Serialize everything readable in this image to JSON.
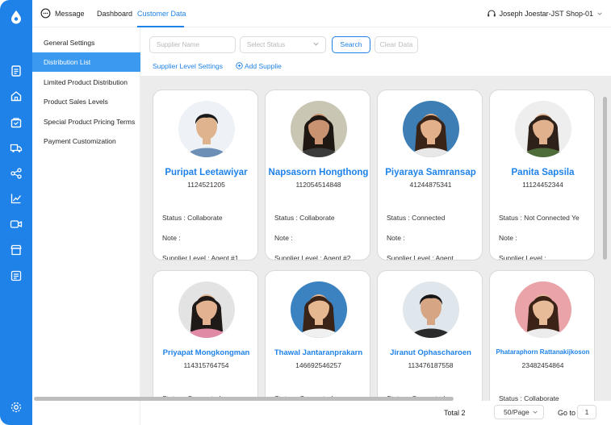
{
  "topbar": {
    "tabs": [
      {
        "label": "Message"
      },
      {
        "label": "Dashboard"
      },
      {
        "label": "Customer Data"
      }
    ],
    "user": "Joseph Joestar-JST Shop-01"
  },
  "menu": {
    "items": [
      {
        "label": "General Settings"
      },
      {
        "label": "Distribution List"
      },
      {
        "label": "Limited Product Distribution"
      },
      {
        "label": "Product Sales Levels"
      },
      {
        "label": "Special Product Pricing Terms"
      },
      {
        "label": "Payment Customization"
      }
    ],
    "active_index": 1
  },
  "filters": {
    "supplier_name_placeholder": "Supplier Name",
    "status_placeholder": "Select Status",
    "search_label": "Search",
    "clear_label": "Clear Data",
    "level_settings_link": "Supplier Level Settings",
    "add_supplier_link": "Add Supplie"
  },
  "labels": {
    "status": "Status : ",
    "note": "Note : ",
    "level": "Supplier Level : "
  },
  "suppliers": [
    {
      "name": "Puripat Leetawiyar",
      "id": "1124521205",
      "status": "Collaborate",
      "note": "",
      "level": "Agent #1",
      "avatar_bg": "#eef2f6",
      "skin": "#e0b38f",
      "hair": "#1a1a1a",
      "shirt": "#6d8fb5",
      "hair_style": "short"
    },
    {
      "name": "Napsasorn Hongthong",
      "id": "112054514848",
      "status": "Collaborate",
      "note": "",
      "level": "Agent #2",
      "avatar_bg": "#c9c6b4",
      "skin": "#c99371",
      "hair": "#1e1712",
      "shirt": "#3b3b3b",
      "hair_style": "long"
    },
    {
      "name": "Piyaraya Samransap",
      "id": "41244875341",
      "status": "Connected",
      "note": "",
      "level": "Agent",
      "avatar_bg": "#3d7fb5",
      "skin": "#e2b08a",
      "hair": "#3a2418",
      "shirt": "#e8e8e8",
      "hair_style": "long"
    },
    {
      "name": "Panita Sapsila",
      "id": "11124452344",
      "status": "Not Connected Ye",
      "note": "",
      "level": "",
      "avatar_bg": "#eeeeee",
      "skin": "#e1b08c",
      "hair": "#2e2119",
      "shirt": "#4e6b3a",
      "hair_style": "long"
    },
    {
      "name": "Priyapat Mongkongman",
      "id": "114315764754",
      "status": "Connected",
      "note": "",
      "level": "",
      "avatar_bg": "#e3e3e3",
      "skin": "#e3b391",
      "hair": "#1f1a17",
      "shirt": "#e08aa6",
      "hair_style": "long"
    },
    {
      "name": "Thawal Jantaranprakarn",
      "id": "146692546257",
      "status": "Connected",
      "note": "",
      "level": "",
      "avatar_bg": "#3b82c0",
      "skin": "#e6b892",
      "hair": "#3a2317",
      "shirt": "#f0f0f0",
      "hair_style": "long"
    },
    {
      "name": "Jiranut Ophascharoen",
      "id": "113476187558",
      "status": "Connected",
      "note": "",
      "level": "",
      "avatar_bg": "#dfe6ec",
      "skin": "#d6a583",
      "hair": "#161616",
      "shirt": "#2b2b2b",
      "hair_style": "short"
    },
    {
      "name": "Phataraphorn Rattanakijkoson",
      "id": "23482454864",
      "status": "Collaborate",
      "note": "",
      "level": "",
      "avatar_bg": "#e9a3a9",
      "skin": "#e8bb98",
      "hair": "#3b2417",
      "shirt": "#ececec",
      "hair_style": "long"
    }
  ],
  "pagination": {
    "total": "Total 2",
    "page_size": "50/Page",
    "goto_label": "Go to",
    "goto_value": "1"
  },
  "colors": {
    "accent": "#1e82e8",
    "menu_active": "#3b9af0",
    "content_bg": "#ececec"
  },
  "icons": {
    "rail": [
      "logo-icon",
      "document-icon",
      "home-icon",
      "box-icon",
      "truck-icon",
      "share-icon",
      "chart-icon",
      "video-icon",
      "store-icon",
      "report-icon",
      "settings-icon"
    ]
  }
}
